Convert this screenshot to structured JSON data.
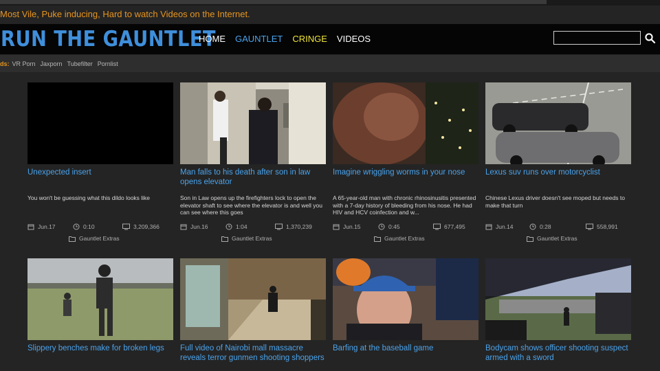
{
  "site": {
    "tagline": "Most Vile, Puke inducing, Hard to watch Videos on the Internet.",
    "logo": "RUN THE GAUNTLET"
  },
  "nav": [
    {
      "label": "HOME"
    },
    {
      "label": "GAUNTLET"
    },
    {
      "label": "CRINGE"
    },
    {
      "label": "VIDEOS"
    }
  ],
  "search": {
    "value": "",
    "icon": "search-icon"
  },
  "friends": {
    "label": "ds:",
    "links": [
      "VR Porn",
      "Jaxporn",
      "Tubefilter",
      "Pornlist"
    ]
  },
  "colors": {
    "accent": "#3f8fdb",
    "link": "#4aa3ec",
    "tagline": "#e8961e",
    "cringe": "#f0e43a"
  },
  "videos": [
    {
      "title": "Unexpected insert",
      "description": "You won't be guessing what this dildo looks like",
      "date": "Jun.17",
      "duration": "0:10",
      "views": "3,209,366",
      "category": "Gauntlet Extras"
    },
    {
      "title": "Man falls to his death after son in law opens elevator",
      "description": "Son in Law opens up the firefighters lock to open the elevator shaft to see where the elevator is and well you can see where this goes",
      "date": "Jun.16",
      "duration": "1:04",
      "views": "1,370,239",
      "category": "Gauntlet Extras"
    },
    {
      "title": "Imagine wriggling worms in your nose",
      "description": "A 65-year-old man with chronic rhinosinusitis presented with a 7-day history of bleeding from his nose. He had HIV and HCV coinfection and w...",
      "date": "Jun.15",
      "duration": "0:45",
      "views": "677,495",
      "category": "Gauntlet Extras"
    },
    {
      "title": "Lexus suv runs over motorcyclist",
      "description": "Chinese Lexus driver doesn't see moped but needs to make that turn",
      "date": "Jun.14",
      "duration": "0:28",
      "views": "558,991",
      "category": "Gauntlet Extras"
    },
    {
      "title": "Slippery benches make for broken legs"
    },
    {
      "title": "Full video of Nairobi mall massacre reveals terror gunmen shooting shoppers"
    },
    {
      "title": "Barfing at the baseball game"
    },
    {
      "title": "Bodycam shows officer shooting suspect armed with a sword"
    }
  ]
}
